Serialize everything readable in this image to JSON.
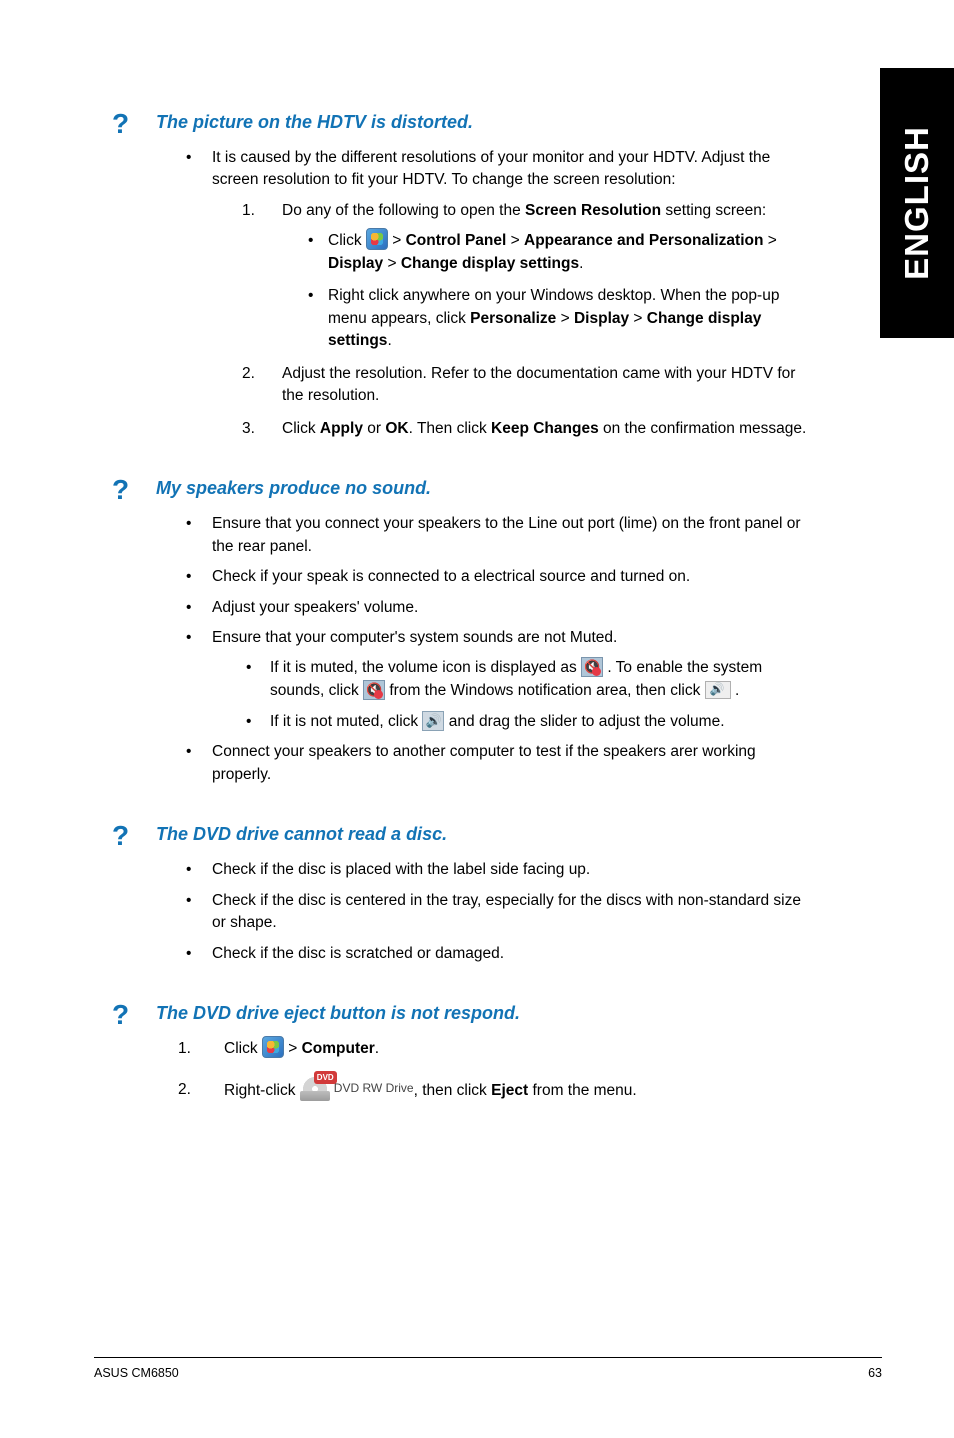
{
  "side_tab": "ENGLISH",
  "sections": [
    {
      "question": "The picture on the HDTV is distorted.",
      "intro": "It is caused by the different resolutions of your monitor and your HDTV. Adjust the screen resolution to fit your HDTV. To change the screen resolution:",
      "step1_lead": "Do any of the following to open the ",
      "step1_bold": "Screen Resolution",
      "step1_tail": " setting screen:",
      "sub1_a_pre": "Click ",
      "sub1_a_b1": "Control Panel",
      "sub1_a_b2": "Appearance and Personalization",
      "sub1_a_b3": "Display",
      "sub1_a_b4": "Change display settings",
      "sub1_b_pre": "Right click anywhere on your Windows desktop. When the pop-up menu appears, click ",
      "sub1_b_b1": "Personalize",
      "sub1_b_b2": "Display",
      "sub1_b_b3": "Change display settings",
      "step2": "Adjust the resolution. Refer to the documentation came with your HDTV for the resolution.",
      "step3_pre": "Click ",
      "step3_b1": "Apply",
      "step3_mid": " or ",
      "step3_b2": "OK",
      "step3_mid2": ". Then click ",
      "step3_b3": "Keep Changes",
      "step3_tail": " on the confirmation message."
    },
    {
      "question": "My speakers produce no sound.",
      "b1": "Ensure that you connect your speakers to the Line out port (lime) on the front panel or the rear panel.",
      "b2": "Check if your speak is connected to a electrical source and turned on.",
      "b3": "Adjust your speakers' volume.",
      "b4": "Ensure that your computer's system sounds are not Muted.",
      "b4a_pre": "If it is muted, the volume icon is displayed as ",
      "b4a_mid": " . To enable the system sounds, click ",
      "b4a_mid2": " from the Windows notification area, then click ",
      "b4a_tail": " .",
      "b4b_pre": "If it is not muted, click ",
      "b4b_tail": " and drag the slider to adjust the volume.",
      "b5": "Connect your speakers to another computer to test if the speakers arer working properly."
    },
    {
      "question": "The DVD drive cannot read a disc.",
      "b1": "Check if the disc is placed with the label side facing up.",
      "b2": "Check if the disc is centered in the tray, especially for the discs with non-standard size or shape.",
      "b3": "Check if the disc is scratched or damaged."
    },
    {
      "question": "The DVD drive eject button is not respond.",
      "s1_pre": "Click ",
      "s1_b": "Computer",
      "s2_pre": "Right-click ",
      "s2_mid": ", then click ",
      "s2_b": "Eject",
      "s2_tail": " from the menu.",
      "dvd_label": "DVD RW Drive",
      "dvd_badge": "DVD"
    }
  ],
  "footer_left": "ASUS CM6850",
  "footer_right": "63"
}
